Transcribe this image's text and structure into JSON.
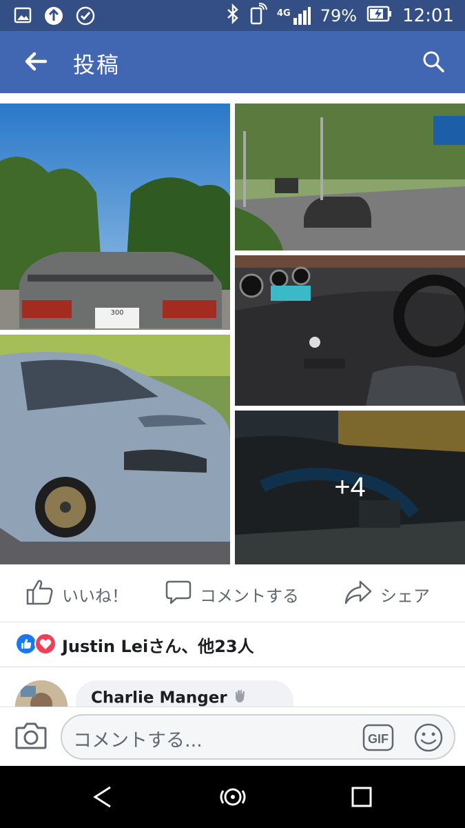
{
  "status_bar": {
    "network": "4G",
    "battery": "79%",
    "time": "12:01"
  },
  "appbar": {
    "title": "投稿"
  },
  "gallery": {
    "more_count": "+4"
  },
  "actions": {
    "like": "いいね！",
    "comment": "コメントする",
    "share": "シェア"
  },
  "reactions": {
    "text": "Justin Leiさん、他23人"
  },
  "comment_preview": {
    "author": "Charlie Manger"
  },
  "composer": {
    "placeholder": "コメントする..."
  },
  "colors": {
    "status_bar": "#344e86",
    "app_bar": "#4267b2",
    "like_blue": "#1877f2",
    "love_red": "#f33e58"
  }
}
